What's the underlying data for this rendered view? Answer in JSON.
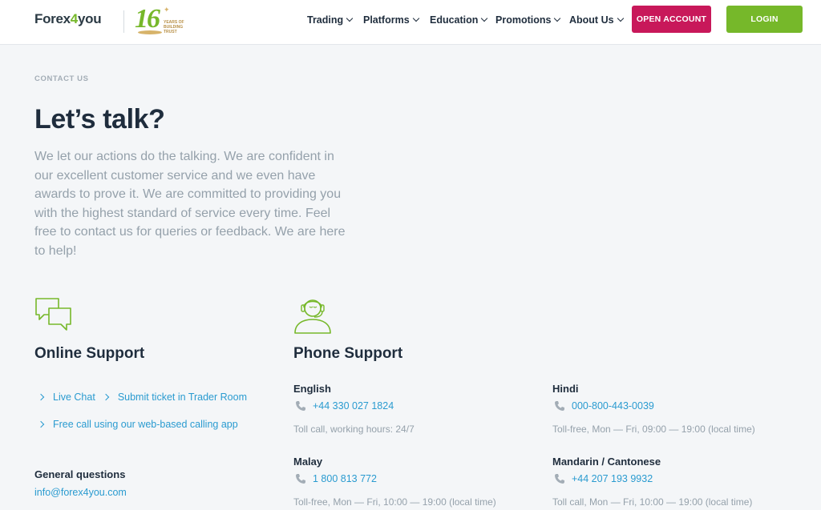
{
  "header": {
    "logo_text_a": "Forex",
    "logo_text_b": "4",
    "logo_text_c": "you",
    "badge": {
      "number": "16",
      "line1": "YEARS OF",
      "line2": "BUILDING",
      "line3": "TRUST"
    },
    "nav": [
      {
        "label": "Trading"
      },
      {
        "label": "Platforms"
      },
      {
        "label": "Education"
      },
      {
        "label": "Promotions"
      },
      {
        "label": "About Us"
      }
    ],
    "open_account_label": "OPEN ACCOUNT",
    "login_label": "LOGIN",
    "colors": {
      "brand_green": "#76b82a",
      "open_account": "#c8185a",
      "link": "#2a9bd0"
    }
  },
  "page": {
    "breadcrumb": "CONTACT US",
    "title": "Let’s talk?",
    "lead": "We let our actions do the talking. We are confident in our excellent customer service and we even have awards to prove it. We are committed to providing you with the highest standard of service every time. Feel free to contact us for queries or feedback. We are here to help!"
  },
  "online_support": {
    "icon": "chat-bubbles-icon",
    "title": "Online Support",
    "links": [
      {
        "label": "Live Chat"
      },
      {
        "label": "Submit ticket in Trader Room"
      },
      {
        "label": "Free call using our web-based calling app"
      }
    ],
    "general_label": "General questions",
    "email": "info@forex4you.com"
  },
  "phone_support": {
    "icon": "support-agent-icon",
    "title": "Phone Support",
    "lines": [
      {
        "language": "English",
        "number": "+44 330 027 1824",
        "note": "Toll call, working hours: 24/7"
      },
      {
        "language": "Hindi",
        "number": "000-800-443-0039",
        "note": "Toll-free, Mon — Fri, 09:00 — 19:00 (local time)"
      },
      {
        "language": "Malay",
        "number": "1 800 813 772",
        "note": "Toll-free, Mon — Fri, 10:00 — 19:00 (local time)"
      },
      {
        "language": "Mandarin / Cantonese",
        "number": "+44 207 193 9932",
        "note": "Toll call, Mon — Fri, 10:00 — 19:00 (local time)"
      }
    ]
  }
}
